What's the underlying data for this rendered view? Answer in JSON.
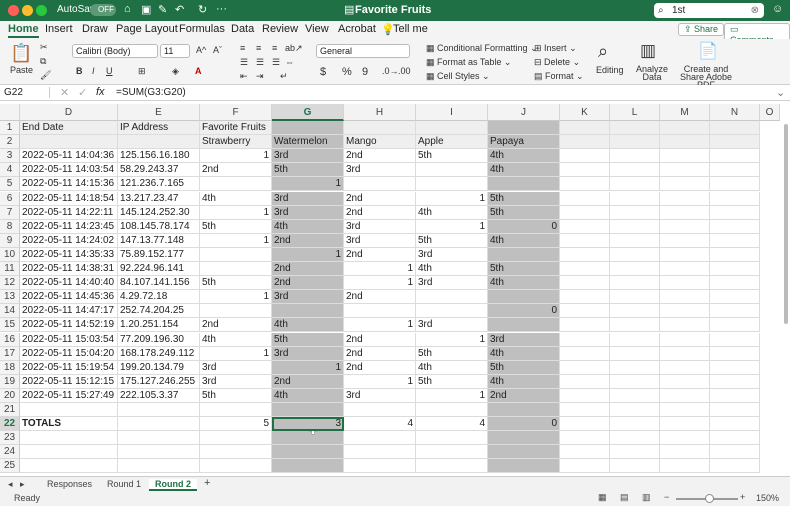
{
  "titlebar": {
    "autosave": "AutoSave",
    "toggle": "OFF",
    "title": "Favorite Fruits",
    "search_value": "1st"
  },
  "tabs": [
    "Home",
    "Insert",
    "Draw",
    "Page Layout",
    "Formulas",
    "Data",
    "Review",
    "View",
    "Acrobat",
    "Tell me"
  ],
  "share": "Share",
  "comments": "Comments",
  "ribbon": {
    "paste": "Paste",
    "font": "Calibri (Body)",
    "size": "11",
    "bold": "B",
    "italic": "I",
    "underline": "U",
    "format": "General",
    "dollar": "$",
    "percent": "%",
    "comma": "9",
    "cond_fmt": "Conditional Formatting",
    "fmt_table": "Format as Table",
    "cell_styles": "Cell Styles",
    "insert": "Insert",
    "delete": "Delete",
    "format_btn": "Format",
    "editing": "Editing",
    "analyze": "Analyze\nData",
    "adobe": "Create and Share Adobe PDF"
  },
  "formula": {
    "cell_ref": "G22",
    "fx": "fx",
    "formula": "=SUM(G3:G20)"
  },
  "columns": [
    "D",
    "E",
    "F",
    "G",
    "H",
    "I",
    "J",
    "K",
    "L",
    "M",
    "N",
    "O"
  ],
  "rows": [
    [
      "End Date",
      "IP Address",
      "Favorite Fruits",
      "",
      "",
      "",
      "",
      "",
      "",
      "",
      ""
    ],
    [
      "",
      "",
      "Strawberry",
      "Watermelon",
      "Mango",
      "Apple",
      "Papaya",
      "",
      "",
      "",
      ""
    ],
    [
      "2022-05-11 14:04:36",
      "125.156.16.180",
      "1",
      "3rd",
      "2nd",
      "5th",
      "4th",
      "",
      "",
      "",
      ""
    ],
    [
      "2022-05-11 14:03:54",
      "58.29.243.37",
      "2nd",
      "5th",
      "3rd",
      "",
      "4th",
      "",
      "",
      "",
      ""
    ],
    [
      "2022-05-11 14:15:36",
      "121.236.7.165",
      "",
      "1",
      "",
      "",
      "",
      "",
      "",
      "",
      ""
    ],
    [
      "2022-05-11 14:18:54",
      "13.217.23.47",
      "4th",
      "3rd",
      "2nd",
      "1",
      "5th",
      "",
      "",
      "",
      ""
    ],
    [
      "2022-05-11 14:22:11",
      "145.124.252.30",
      "1",
      "3rd",
      "2nd",
      "4th",
      "5th",
      "",
      "",
      "",
      ""
    ],
    [
      "2022-05-11 14:23:45",
      "108.145.78.174",
      "5th",
      "4th",
      "3rd",
      "1",
      "0",
      "",
      "",
      "",
      ""
    ],
    [
      "2022-05-11 14:24:02",
      "147.13.77.148",
      "1",
      "2nd",
      "3rd",
      "5th",
      "4th",
      "",
      "",
      "",
      ""
    ],
    [
      "2022-05-11 14:35:33",
      "75.89.152.177",
      "",
      "1",
      "2nd",
      "3rd",
      "",
      "",
      "",
      "",
      ""
    ],
    [
      "2022-05-11 14:38:31",
      "92.224.96.141",
      "",
      "2nd",
      "1",
      "4th",
      "5th",
      "",
      "",
      "",
      ""
    ],
    [
      "2022-05-11 14:40:40",
      "84.107.141.156",
      "5th",
      "2nd",
      "1",
      "3rd",
      "4th",
      "",
      "",
      "",
      ""
    ],
    [
      "2022-05-11 14:45:36",
      "4.29.72.18",
      "1",
      "3rd",
      "2nd",
      "",
      "",
      "",
      "",
      "",
      ""
    ],
    [
      "2022-05-11 14:47:17",
      "252.74.204.25",
      "",
      "",
      "",
      "",
      "0",
      "",
      "",
      "",
      ""
    ],
    [
      "2022-05-11 14:52:19",
      "1.20.251.154",
      "2nd",
      "4th",
      "1",
      "3rd",
      "",
      "",
      "",
      "",
      ""
    ],
    [
      "2022-05-11 15:03:54",
      "77.209.196.30",
      "4th",
      "5th",
      "2nd",
      "1",
      "3rd",
      "",
      "",
      "",
      ""
    ],
    [
      "2022-05-11 15:04:20",
      "168.178.249.112",
      "1",
      "3rd",
      "2nd",
      "5th",
      "4th",
      "",
      "",
      "",
      ""
    ],
    [
      "2022-05-11 15:19:54",
      "199.20.134.79",
      "3rd",
      "1",
      "2nd",
      "4th",
      "5th",
      "",
      "",
      "",
      ""
    ],
    [
      "2022-05-11 15:12:15",
      "175.127.246.255",
      "3rd",
      "2nd",
      "1",
      "5th",
      "4th",
      "",
      "",
      "",
      ""
    ],
    [
      "2022-05-11 15:27:49",
      "222.105.3.37",
      "5th",
      "4th",
      "3rd",
      "1",
      "2nd",
      "",
      "",
      "",
      ""
    ],
    [
      "",
      "",
      "",
      "",
      "",
      "",
      "",
      "",
      "",
      "",
      ""
    ],
    [
      "TOTALS",
      "",
      "5",
      "3",
      "4",
      "4",
      "0",
      "",
      "",
      "",
      ""
    ],
    [
      "",
      "",
      "",
      "",
      "",
      "",
      "",
      "",
      "",
      "",
      ""
    ],
    [
      "",
      "",
      "",
      "",
      "",
      "",
      "",
      "",
      "",
      "",
      ""
    ],
    [
      "",
      "",
      "",
      "",
      "",
      "",
      "",
      "",
      "",
      "",
      ""
    ]
  ],
  "sheets": [
    "Responses",
    "Round 1",
    "Round 2"
  ],
  "status": {
    "ready": "Ready",
    "zoom": "150%"
  }
}
